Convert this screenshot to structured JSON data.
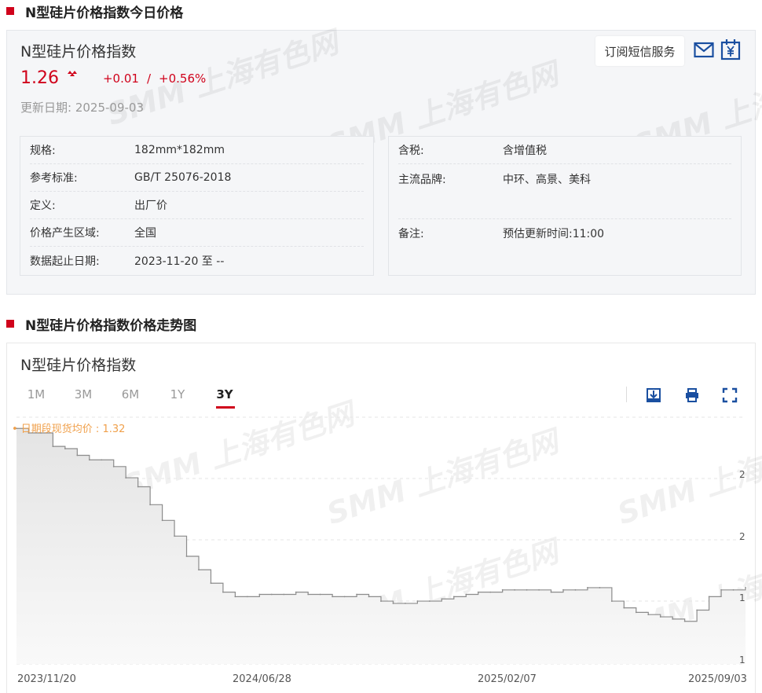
{
  "section1": {
    "title": "N型硅片价格指数今日价格"
  },
  "product": {
    "name": "N型硅片价格指数",
    "price": "1.26",
    "change": "+0.01",
    "separator": "/",
    "change_pct": "+0.56%",
    "update_label": "更新日期:",
    "update_date": "2025-09-03",
    "trend_icon": "up-arrows-icon"
  },
  "sms": {
    "label": "订阅短信服务"
  },
  "info_left": [
    {
      "key": "规格:",
      "value": "182mm*182mm"
    },
    {
      "key": "参考标准:",
      "value": "GB/T 25076-2018"
    },
    {
      "key": "定义:",
      "value": "出厂价"
    },
    {
      "key": "价格产生区域:",
      "value": "全国"
    },
    {
      "key": "数据起止日期:",
      "value": "2023-11-20 至 --"
    }
  ],
  "info_right": [
    {
      "key": "含税:",
      "value": "含增值税"
    },
    {
      "key": "主流品牌:",
      "value": "中环、高景、美科"
    },
    {
      "key": "备注:",
      "value": "预估更新时间:11:00"
    }
  ],
  "section2": {
    "title": "N型硅片价格指数价格走势图"
  },
  "chart": {
    "title": "N型硅片价格指数",
    "ranges": [
      "1M",
      "3M",
      "6M",
      "1Y",
      "3Y"
    ],
    "active_range": "3Y",
    "avg_label": "• 日期段现货均价 : 1.32",
    "tools": [
      "download-icon",
      "print-icon",
      "fullscreen-icon"
    ],
    "x_labels": [
      "2023/11/20",
      "2024/06/28",
      "2025/02/07",
      "2025/09/03"
    ],
    "y_tick_labels": [
      "2",
      "2",
      "1",
      "1"
    ],
    "watermark": "SMM 上海有色网",
    "accent_color": "#d0021b",
    "avg_color": "#f0a04b"
  },
  "chart_data": {
    "type": "area",
    "title": "N型硅片价格指数",
    "x_start": "2023-11-20",
    "x_end": "2025-09-03",
    "y_range": [
      1.0,
      2.1
    ],
    "average": 1.32,
    "series": [
      {
        "values": [
          2.05,
          2.03,
          2.03,
          1.97,
          1.96,
          1.93,
          1.91,
          1.91,
          1.88,
          1.83,
          1.79,
          1.71,
          1.64,
          1.57,
          1.48,
          1.42,
          1.36,
          1.32,
          1.3,
          1.3,
          1.31,
          1.31,
          1.31,
          1.32,
          1.31,
          1.31,
          1.3,
          1.3,
          1.31,
          1.3,
          1.28,
          1.27,
          1.27,
          1.28,
          1.28,
          1.29,
          1.3,
          1.31,
          1.32,
          1.32,
          1.33,
          1.33,
          1.33,
          1.33,
          1.32,
          1.33,
          1.33,
          1.34,
          1.34,
          1.28,
          1.25,
          1.23,
          1.22,
          1.21,
          1.2,
          1.19,
          1.24,
          1.3,
          1.33,
          1.33,
          1.34
        ]
      }
    ]
  }
}
